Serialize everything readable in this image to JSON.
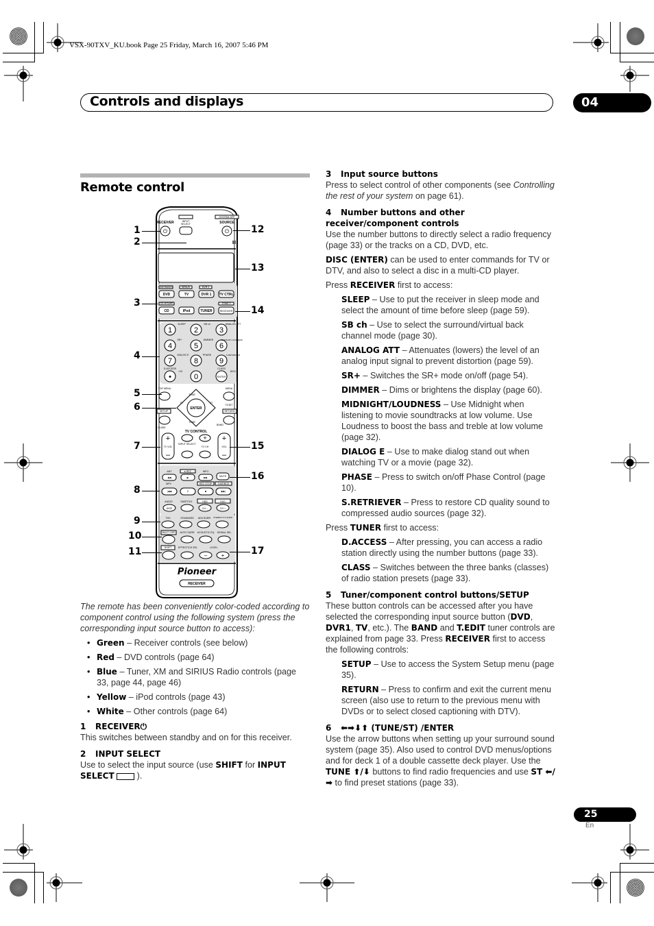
{
  "book_header": "VSX-90TXV_KU.book  Page 25  Friday, March 16, 2007  5:46 PM",
  "chapter": {
    "title": "Controls and displays",
    "number": "04"
  },
  "section": {
    "title": "Remote control"
  },
  "remote": {
    "callouts_left": [
      "1",
      "2",
      "3",
      "4",
      "5",
      "6",
      "7",
      "8",
      "9",
      "10",
      "11"
    ],
    "callouts_right": [
      "12",
      "13",
      "14",
      "15",
      "16",
      "17"
    ],
    "labels": {
      "receiver": "RECEIVER",
      "input_select_top": "INPUT",
      "input_select_bottom": "SELECT",
      "system_off": "SYSTEM OFF",
      "source": "SOURCE",
      "xm_radio": "XM RADIO",
      "sirius": "SIRIUS",
      "dvr2": "DVR 2",
      "dvd": "DVD",
      "tv": "TV",
      "dvr1": "DVR 1",
      "tv_ctrl": "TV CTRL",
      "cdr_tape": "CD-R/TAPE",
      "zone2": "ZONE 2",
      "cd": "CD",
      "ipod": "iPod",
      "tuner": "TUNER",
      "receiver_small": "RECEIVER",
      "numbers": [
        "1",
        "2",
        "3",
        "4",
        "5",
        "6",
        "7",
        "8",
        "9",
        "•",
        "0",
        "ENTER"
      ],
      "num_sub": [
        "SLEEP",
        "SB ch",
        "ANALOG ATT",
        "SR+",
        "DIMMER",
        "MIDNIGHT LOUDNESS",
        "DIALOG E",
        "PHASE",
        "S.RETRIEVER",
        "D.ACCESS",
        "+10",
        "CLASS"
      ],
      "disc": "DISC",
      "top_menu": "TOP MENU",
      "menu": "MENU",
      "tune": "TUNE",
      "st": "ST",
      "enter": "ENTER",
      "t_edit": "T.EDIT",
      "setup": "SETUP",
      "return": "RETURN",
      "guide": "GUIDE",
      "band": "BAND",
      "tv_control": "TV CONTROL",
      "tv_vol": "TV VOL",
      "input_select": "INPUT SELECT",
      "tv_ch": "TV CH",
      "vol": "VOL",
      "ant": "ANT",
      "rec": "● REC",
      "info": "INFO",
      "mute": "MUTE",
      "mpx": "MPX",
      "rec_stop": "REC STOP",
      "jukebox": "JUKEBOX",
      "audio": "AUDIO",
      "subtitle": "SUBTITLE",
      "hdd": "HDD",
      "dvd_small": "DVD",
      "disp": "DISP",
      "ch_minus": "CH –",
      "ch_plus": "CH +",
      "thx": "THX",
      "standard": "STANDARD",
      "adv_surr": "ADV.SURR",
      "stereo": "STEREO/ F.S.SURR",
      "multi_ope": "MULTI OPE",
      "auto_surr": "AUTO SURR",
      "acoustic_eq": "ACOUSTIC EQ",
      "signal_sel": "SIGNAL SEL",
      "shift": "SHIFT",
      "effect": "EFFECT/CH SEL",
      "level": "LEVEL",
      "brand": "Pioneer",
      "footer": "RECEIVER"
    }
  },
  "left_text": {
    "intro": "The remote has been conveniently color-coded according to component control using the following system (press the corresponding input source button to access):",
    "bullets": [
      {
        "bold": "Green",
        "text": " – Receiver controls (see below)"
      },
      {
        "bold": "Red",
        "text": " – DVD controls (page 64)"
      },
      {
        "bold": "Blue",
        "text": " – Tuner, XM and SIRIUS Radio controls (page 33, page 44, page 46)"
      },
      {
        "bold": "Yellow",
        "text": " – iPod controls (page 43)"
      },
      {
        "bold": "White",
        "text": " – Other controls (page 64)"
      }
    ],
    "item1": {
      "num": "1",
      "title": "RECEIVER⏻",
      "body": "This switches between standby and on for this receiver."
    },
    "item2": {
      "num": "2",
      "title": "INPUT SELECT",
      "body_a": "Use to select the input source (use ",
      "shift": "SHIFT",
      "body_b": " for ",
      "input": "INPUT SELECT",
      "body_c": " )."
    }
  },
  "right_text": {
    "item3": {
      "num": "3",
      "title": "Input source buttons",
      "body_a": "Press to select control of other components (see ",
      "italic": "Controlling the rest of your system",
      "body_b": " on page 61)."
    },
    "item4": {
      "num": "4",
      "title": "Number buttons and other receiver/component controls",
      "body": "Use the number buttons to directly select a radio frequency (page 33) or the tracks on a CD, DVD, etc.",
      "disc_bold": "DISC (ENTER)",
      "disc_text": " can be used to enter commands for TV or DTV, and also to select a disc in a multi-CD player.",
      "press_a": "Press ",
      "press_bold": "RECEIVER",
      "press_b": " first to access:"
    },
    "receiver_items": [
      {
        "bold": "SLEEP",
        "text": " – Use to put the receiver in sleep mode and select the amount of time before sleep (page 59)."
      },
      {
        "bold": "SB ch",
        "text": " – Use to select the surround/virtual back channel mode (page 30)."
      },
      {
        "bold": "ANALOG ATT",
        "text": " – Attenuates (lowers) the level of an analog input signal to prevent distortion (page 59)."
      },
      {
        "bold": "SR+",
        "text": " – Switches the SR+ mode on/off (page 54)."
      },
      {
        "bold": "DIMMER",
        "text": " – Dims or brightens the display (page 60)."
      },
      {
        "bold": "MIDNIGHT/LOUDNESS",
        "text": " – Use Midnight when listening to movie soundtracks at low volume. Use Loudness to boost the bass and treble at low volume (page 32)."
      },
      {
        "bold": "DIALOG E",
        "text": " – Use to make dialog stand out when watching TV or a movie (page 32)."
      },
      {
        "bold": "PHASE",
        "text": " – Press to switch on/off Phase Control (page 10)."
      },
      {
        "bold": "S.RETRIEVER",
        "text": " – Press to restore CD quality sound to compressed audio sources (page 32)."
      }
    ],
    "press_tuner": {
      "a": "Press ",
      "bold": "TUNER",
      "b": " first to access:"
    },
    "tuner_items": [
      {
        "bold": "D.ACCESS",
        "text": " – After pressing, you can access a radio station directly using the number buttons (page 33)."
      },
      {
        "bold": "CLASS",
        "text": " – Switches between the three banks (classes) of radio station presets (page 33)."
      }
    ],
    "item5": {
      "num": "5",
      "title": "Tuner/component control buttons/SETUP",
      "t1": "These button controls can be accessed after you have selected the corresponding input source button (",
      "b1": "DVD",
      "t2": ", ",
      "b2": "DVR1",
      "t3": ", ",
      "b3": "TV",
      "t4": ", etc.). The ",
      "b4": "BAND",
      "t5": " and ",
      "b5": "T.EDIT",
      "t6": " tuner controls are explained from page 33. Press ",
      "b6": "RECEIVER",
      "t7": " first to access the following controls:"
    },
    "setup_items": [
      {
        "bold": "SETUP",
        "text": " – Use to access the System Setup menu (page 35)."
      },
      {
        "bold": "RETURN",
        "text": " – Press to confirm and exit the current menu screen (also use to return to the previous menu with DVDs or to select closed captioning with DTV)."
      }
    ],
    "item6": {
      "num": "6",
      "title": "⬅➡⬇⬆ (TUNE/ST) /ENTER",
      "t1": "Use the arrow buttons when setting up your surround sound system (page 35). Also used to control DVD menus/options and for deck 1 of a double cassette deck player. Use the ",
      "b1": "TUNE ⬆/⬇",
      "t2": " buttons to find radio frequencies and use ",
      "b2": "ST ⬅/➡",
      "t3": " to find preset stations (page 33)."
    }
  },
  "footer": {
    "page": "25",
    "lang": "En"
  }
}
